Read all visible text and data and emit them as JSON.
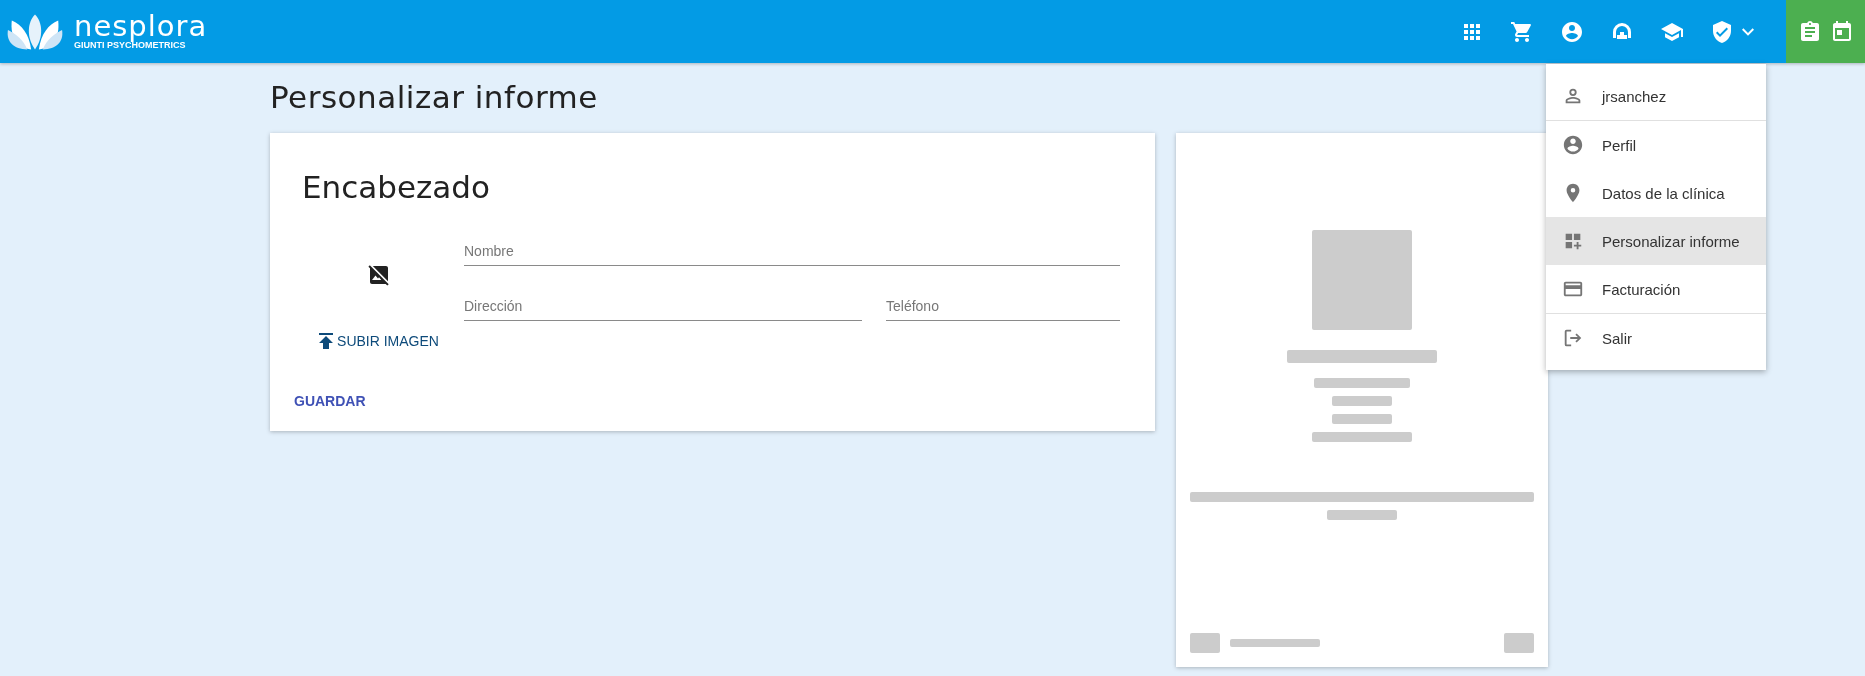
{
  "header": {
    "logo": {
      "name": "nesplora",
      "tagline": "GIUNTI PSYCHOMETRICS"
    },
    "icons": [
      {
        "kind": "apps"
      },
      {
        "kind": "cart"
      },
      {
        "kind": "account"
      },
      {
        "kind": "support"
      },
      {
        "kind": "school"
      },
      {
        "kind": "shield",
        "dropdown": true
      }
    ],
    "side_icons": [
      {
        "kind": "clipboard"
      },
      {
        "kind": "calendar"
      }
    ]
  },
  "page_title": "Personalizar informe",
  "form": {
    "title": "Encabezado",
    "upload_button": "SUBIR IMAGEN",
    "fields": [
      {
        "placeholder": "Nombre"
      },
      {
        "placeholder": "Dirección"
      },
      {
        "placeholder": "Teléfono"
      }
    ],
    "save_button": "GUARDAR"
  },
  "user_menu": {
    "sections": [
      [
        {
          "label": "jrsanchez",
          "kind": "person",
          "selected": false
        }
      ],
      [
        {
          "label": "Perfil",
          "kind": "account",
          "selected": false
        },
        {
          "label": "Datos de la clínica",
          "kind": "pin",
          "selected": false
        },
        {
          "label": "Personalizar informe",
          "kind": "dashboard",
          "selected": true
        },
        {
          "label": "Facturación",
          "kind": "card",
          "selected": false
        }
      ],
      [
        {
          "label": "Salir",
          "kind": "logout",
          "selected": false
        }
      ]
    ]
  }
}
